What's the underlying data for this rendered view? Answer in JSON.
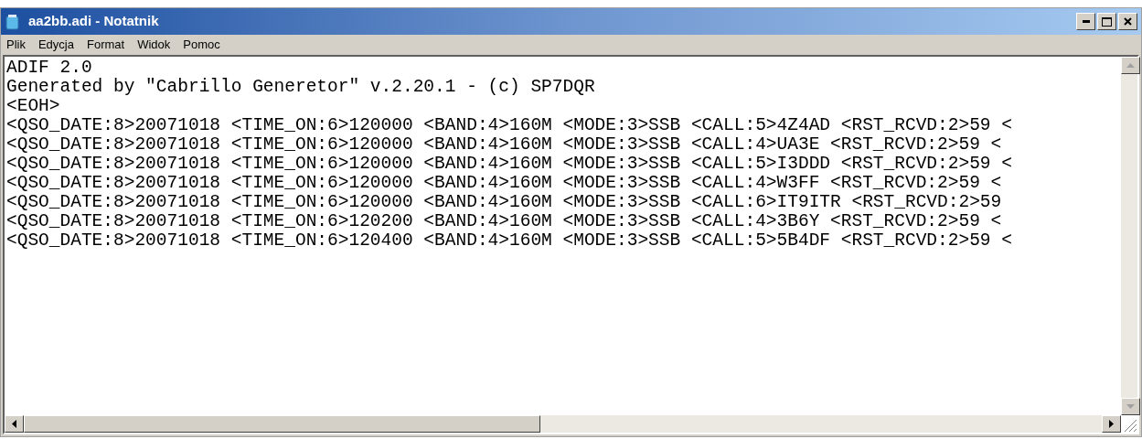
{
  "window": {
    "title": "aa2bb.adi - Notatnik"
  },
  "menu": [
    "Plik",
    "Edycja",
    "Format",
    "Widok",
    "Pomoc"
  ],
  "editor": {
    "lines": [
      "ADIF 2.0",
      "Generated by \"Cabrillo Generetor\" v.2.20.1 - (c) SP7DQR",
      "<EOH>",
      "<QSO_DATE:8>20071018 <TIME_ON:6>120000 <BAND:4>160M <MODE:3>SSB <CALL:5>4Z4AD <RST_RCVD:2>59 <",
      "<QSO_DATE:8>20071018 <TIME_ON:6>120000 <BAND:4>160M <MODE:3>SSB <CALL:4>UA3E <RST_RCVD:2>59 <",
      "<QSO_DATE:8>20071018 <TIME_ON:6>120000 <BAND:4>160M <MODE:3>SSB <CALL:5>I3DDD <RST_RCVD:2>59 <",
      "<QSO_DATE:8>20071018 <TIME_ON:6>120000 <BAND:4>160M <MODE:3>SSB <CALL:4>W3FF <RST_RCVD:2>59 <",
      "<QSO_DATE:8>20071018 <TIME_ON:6>120000 <BAND:4>160M <MODE:3>SSB <CALL:6>IT9ITR <RST_RCVD:2>59",
      "<QSO_DATE:8>20071018 <TIME_ON:6>120200 <BAND:4>160M <MODE:3>SSB <CALL:4>3B6Y <RST_RCVD:2>59 <",
      "<QSO_DATE:8>20071018 <TIME_ON:6>120400 <BAND:4>160M <MODE:3>SSB <CALL:5>5B4DF <RST_RCVD:2>59 <"
    ]
  }
}
